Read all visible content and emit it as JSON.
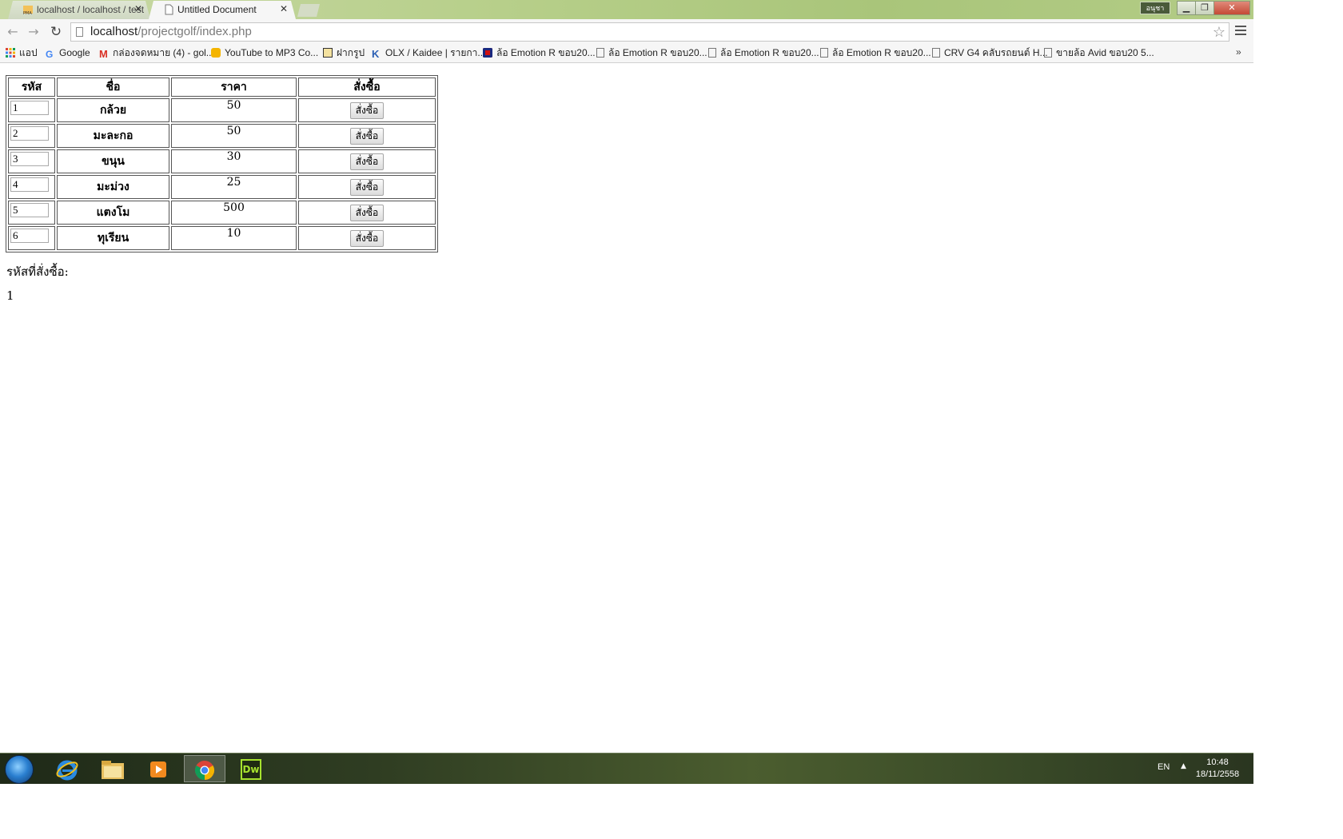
{
  "browser": {
    "tabs": [
      {
        "label": "localhost / localhost / test",
        "active": false,
        "icon": "phpmyadmin-icon"
      },
      {
        "label": "Untitled Document",
        "active": true,
        "icon": "page-icon"
      }
    ],
    "user_badge": "อนุชา",
    "url_host": "localhost",
    "url_path": "/projectgolf/index.php"
  },
  "bookmarks": [
    {
      "label": "แอป",
      "icon": "apps-icon"
    },
    {
      "label": "Google",
      "icon": "google-icon"
    },
    {
      "label": "กล่องจดหมาย (4) - gol...",
      "icon": "gmail-icon"
    },
    {
      "label": "YouTube to MP3 Co...",
      "icon": "converter-icon"
    },
    {
      "label": "ฝากรูป",
      "icon": "photo-icon"
    },
    {
      "label": "OLX / Kaidee | รายกา...",
      "icon": "kaidee-icon"
    },
    {
      "label": "ล้อ Emotion R ขอบ20...",
      "icon": "wheel-icon"
    },
    {
      "label": "ล้อ Emotion R ขอบ20...",
      "icon": "page-icon"
    },
    {
      "label": "ล้อ Emotion R ขอบ20...",
      "icon": "page-icon"
    },
    {
      "label": "ล้อ Emotion R ขอบ20...",
      "icon": "page-icon"
    },
    {
      "label": "CRV G4 คลับรถยนต์ H...",
      "icon": "page-icon"
    },
    {
      "label": "ขายล้อ Avid ขอบ20 5...",
      "icon": "page-icon"
    }
  ],
  "table": {
    "headers": [
      "รหัส",
      "ชื่อ",
      "ราคา",
      "สั่งซื้อ"
    ],
    "rows": [
      {
        "code": "1",
        "name": "กล้วย",
        "price": "50",
        "button": "สั่งซื้อ"
      },
      {
        "code": "2",
        "name": "มะละกอ",
        "price": "50",
        "button": "สั่งซื้อ"
      },
      {
        "code": "3",
        "name": "ขนุน",
        "price": "30",
        "button": "สั่งซื้อ"
      },
      {
        "code": "4",
        "name": "มะม่วง",
        "price": "25",
        "button": "สั่งซื้อ"
      },
      {
        "code": "5",
        "name": "แตงโม",
        "price": "500",
        "button": "สั่งซื้อ"
      },
      {
        "code": "6",
        "name": "ทุเรียน",
        "price": "10",
        "button": "สั่งซื้อ"
      }
    ]
  },
  "order": {
    "label": "รหัสที่สั่งซื้อ:",
    "value": "1"
  },
  "taskbar": {
    "items": [
      {
        "name": "internet-explorer-icon",
        "active": false
      },
      {
        "name": "file-explorer-icon",
        "active": false
      },
      {
        "name": "media-player-icon",
        "active": false
      },
      {
        "name": "chrome-icon",
        "active": true
      },
      {
        "name": "dreamweaver-icon",
        "active": false,
        "label": "Dw"
      }
    ],
    "language": "EN",
    "time": "10:48",
    "date": "18/11/2558"
  },
  "colors": {
    "dreamweaver": "#a6e22e",
    "chrome_red": "#db4437",
    "chrome_yellow": "#f4b400",
    "chrome_green": "#0f9d58",
    "chrome_blue": "#4285f4"
  }
}
